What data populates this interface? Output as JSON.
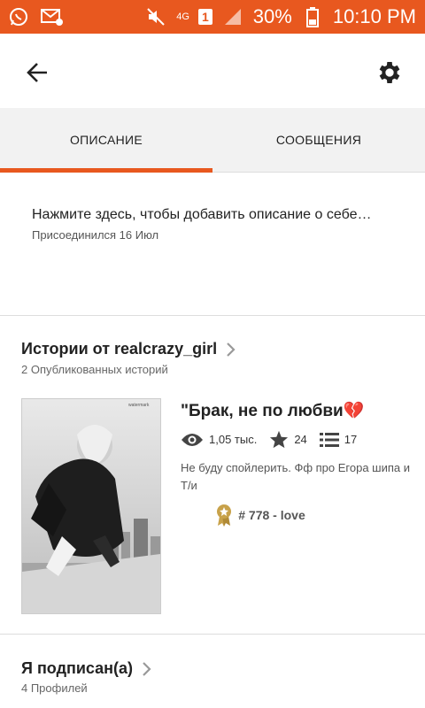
{
  "status_bar": {
    "network": "4G",
    "sim": "1",
    "battery": "30%",
    "time": "10:10 PM"
  },
  "tabs": [
    {
      "label": "ОПИСАНИЕ",
      "active": true
    },
    {
      "label": "СООБЩЕНИЯ",
      "active": false
    }
  ],
  "about": {
    "description": "Нажмите здесь, чтобы добавить описание о себе…",
    "joined": "Присоединился 16 Июл"
  },
  "stories_section": {
    "title": "Истории от realcrazy_girl",
    "subtitle": "2 Опубликованных историй"
  },
  "story": {
    "title": "\"Брак, не по любви💔",
    "views": "1,05 тыс.",
    "votes": "24",
    "parts": "17",
    "description": "Не буду спойлерить. Фф про Егора шипа и Т/и",
    "rank": "# 778 - love"
  },
  "following_section": {
    "title": "Я подписан(а)",
    "subtitle": "4 Профилей"
  },
  "colors": {
    "accent": "#e8581f",
    "tab_bg": "#f2f2f2",
    "gold_badge": "#c8a24a"
  }
}
